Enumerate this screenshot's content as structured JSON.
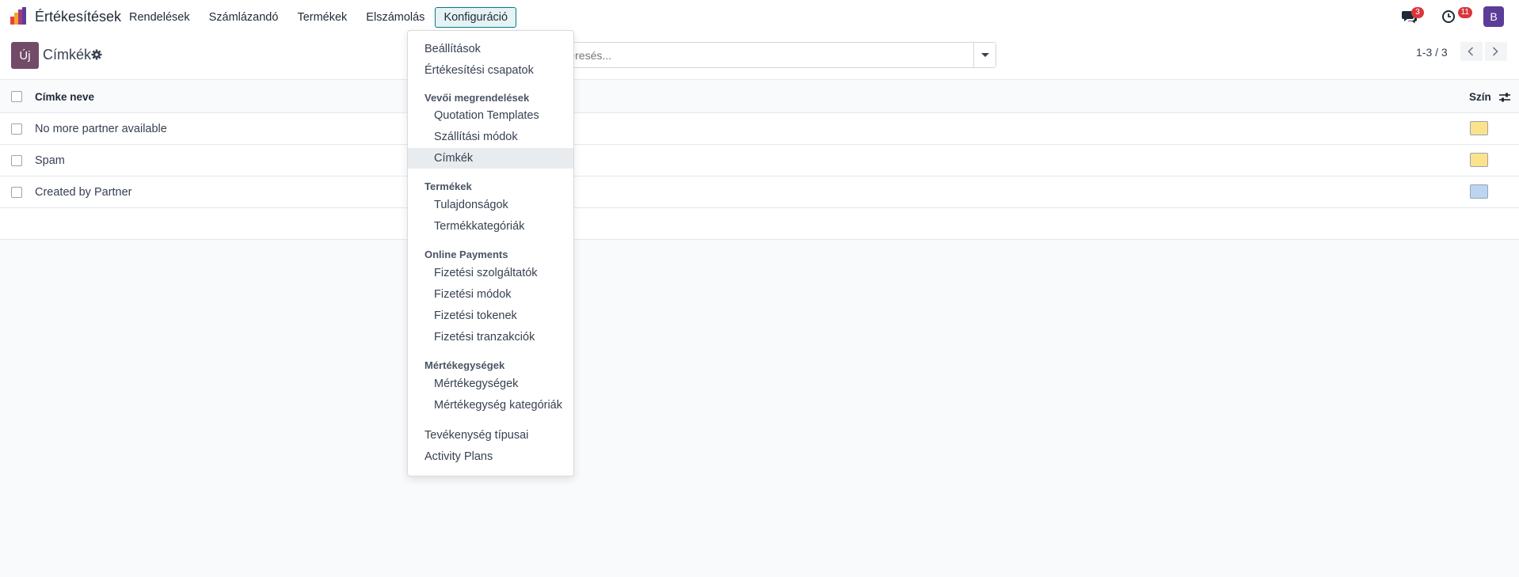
{
  "navbar": {
    "app_name": "Értékesítések",
    "menu": [
      "Rendelések",
      "Számlázandó",
      "Termékek",
      "Elszámolás",
      "Konfiguráció"
    ],
    "open_menu": "Konfiguráció",
    "messages_count": "3",
    "activities_count": "11",
    "avatar_letter": "B"
  },
  "control_panel": {
    "new_label": "Új",
    "title": "Címkék",
    "search_placeholder": "Keresés...",
    "pager": "1-3 / 3"
  },
  "list": {
    "columns": {
      "name": "Címke neve",
      "color": "Szín"
    },
    "rows": [
      {
        "name": "No more partner available",
        "color": "#fbe38d"
      },
      {
        "name": "Spam",
        "color": "#fbe38d"
      },
      {
        "name": "Created by Partner",
        "color": "#bcd5f0"
      }
    ]
  },
  "dropdown": {
    "items": [
      {
        "type": "item",
        "label": "Beállítások"
      },
      {
        "type": "item",
        "label": "Értékesítési csapatok"
      },
      {
        "type": "section",
        "label": "Vevői megrendelések"
      },
      {
        "type": "sub",
        "label": "Quotation Templates"
      },
      {
        "type": "sub",
        "label": "Szállítási módok"
      },
      {
        "type": "sub",
        "label": "Címkék",
        "active": true
      },
      {
        "type": "section",
        "label": "Termékek"
      },
      {
        "type": "sub",
        "label": "Tulajdonságok"
      },
      {
        "type": "sub",
        "label": "Termékkategóriák"
      },
      {
        "type": "section",
        "label": "Online Payments"
      },
      {
        "type": "sub",
        "label": "Fizetési szolgáltatók"
      },
      {
        "type": "sub",
        "label": "Fizetési módok"
      },
      {
        "type": "sub",
        "label": "Fizetési tokenek"
      },
      {
        "type": "sub",
        "label": "Fizetési tranzakciók"
      },
      {
        "type": "section",
        "label": "Mértékegységek"
      },
      {
        "type": "sub",
        "label": "Mértékegységek"
      },
      {
        "type": "sub",
        "label": "Mértékegység kategóriák"
      },
      {
        "type": "item",
        "label": "Tevékenység típusai"
      },
      {
        "type": "item",
        "label": "Activity Plans"
      }
    ]
  },
  "colors": {
    "brand": "#714b67",
    "accent": "#017e84",
    "badge": "#d9363e",
    "avatar": "#5b3d99"
  }
}
